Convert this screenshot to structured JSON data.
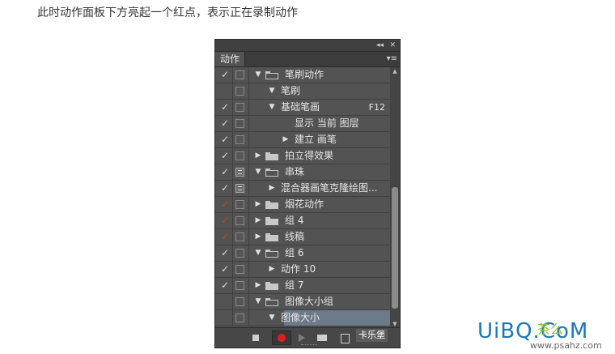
{
  "caption": "此时动作面板下方亮起一个红点，表示正在录制动作",
  "panel": {
    "collapse_glyph": "◂◂",
    "close_glyph": "✕",
    "tab_label": "动作",
    "menu_glyph": "▾≡",
    "rows": [
      {
        "check": "✓",
        "check_color": "normal",
        "dialog": false,
        "indent": 0,
        "expander": "▼",
        "folder": "open",
        "label": "笔刷动作",
        "key": ""
      },
      {
        "check": "",
        "check_color": "normal",
        "dialog": false,
        "indent": 1,
        "expander": "▼",
        "folder": "",
        "label": "笔刷",
        "key": ""
      },
      {
        "check": "✓",
        "check_color": "normal",
        "dialog": false,
        "indent": 1,
        "expander": "▼",
        "folder": "",
        "label": "基础笔画",
        "key": "F12"
      },
      {
        "check": "✓",
        "check_color": "normal",
        "dialog": false,
        "indent": 2,
        "expander": "",
        "folder": "",
        "label": "显示 当前 图层",
        "key": ""
      },
      {
        "check": "✓",
        "check_color": "normal",
        "dialog": false,
        "indent": 2,
        "expander": "▶",
        "folder": "",
        "label": "建立 画笔",
        "key": ""
      },
      {
        "check": "✓",
        "check_color": "normal",
        "dialog": false,
        "indent": 0,
        "expander": "▶",
        "folder": "closed",
        "label": "拍立得效果",
        "key": ""
      },
      {
        "check": "✓",
        "check_color": "normal",
        "dialog": true,
        "indent": 0,
        "expander": "▼",
        "folder": "open",
        "label": "串珠",
        "key": ""
      },
      {
        "check": "✓",
        "check_color": "normal",
        "dialog": true,
        "indent": 1,
        "expander": "▶",
        "folder": "",
        "label": "混合器画笔克隆绘图...",
        "key": ""
      },
      {
        "check": "✓",
        "check_color": "red",
        "dialog": false,
        "indent": 0,
        "expander": "▶",
        "folder": "closed",
        "label": "烟花动作",
        "key": ""
      },
      {
        "check": "✓",
        "check_color": "red",
        "dialog": false,
        "indent": 0,
        "expander": "▶",
        "folder": "closed",
        "label": "组 4",
        "key": ""
      },
      {
        "check": "✓",
        "check_color": "red",
        "dialog": false,
        "indent": 0,
        "expander": "▶",
        "folder": "closed",
        "label": "线稿",
        "key": ""
      },
      {
        "check": "✓",
        "check_color": "normal",
        "dialog": false,
        "indent": 0,
        "expander": "▼",
        "folder": "open",
        "label": "组 6",
        "key": ""
      },
      {
        "check": "✓",
        "check_color": "normal",
        "dialog": false,
        "indent": 1,
        "expander": "▶",
        "folder": "",
        "label": "动作 10",
        "key": ""
      },
      {
        "check": "✓",
        "check_color": "normal",
        "dialog": false,
        "indent": 0,
        "expander": "▶",
        "folder": "closed",
        "label": "组 7",
        "key": ""
      },
      {
        "check": "",
        "check_color": "normal",
        "dialog": false,
        "indent": 0,
        "expander": "▼",
        "folder": "open",
        "label": "图像大小组",
        "key": ""
      },
      {
        "check": "",
        "check_color": "normal",
        "dialog": false,
        "indent": 1,
        "expander": "▼",
        "folder": "",
        "label": "图像大小",
        "key": "",
        "selected": true
      }
    ],
    "scroll_up_glyph": "▲",
    "scroll_down_glyph": "▼"
  },
  "colors": {
    "record_dot": "#e02020",
    "panel_bg": "#535353",
    "selection": "#6d7a8a"
  },
  "watermarks": {
    "badge": "卡乐堡",
    "logo": "UiBQ.CoM",
    "sub": "茶么",
    "url": "www.psahz.com"
  }
}
